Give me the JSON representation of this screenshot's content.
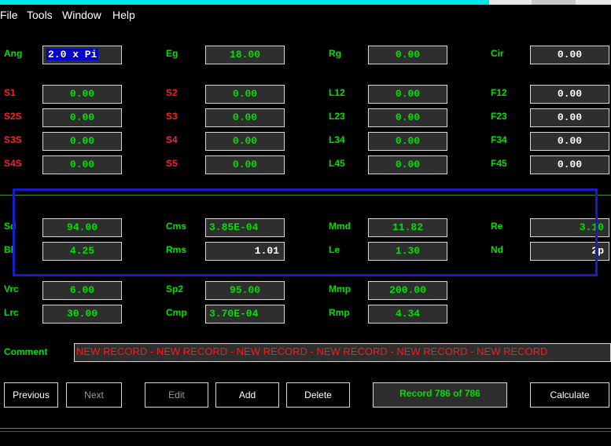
{
  "colors": {
    "accent_titlebar": "#00e5e5",
    "label_green": "#00e000",
    "label_red": "#ff2020",
    "value_green": "#00e000",
    "value_white": "#ffffff",
    "highlight_blue": "#1a1acc",
    "comment_red": "#ff1a1a"
  },
  "menu": [
    "File",
    "Tools",
    "Window",
    "Help"
  ],
  "fields": {
    "ang": {
      "label": "Ang",
      "value": "2.0 x Pi"
    },
    "eg": {
      "label": "Eg",
      "value": "18.00"
    },
    "rg": {
      "label": "Rg",
      "value": "0.00"
    },
    "cir": {
      "label": "Cir",
      "value": "0.00"
    },
    "s1": {
      "label": "S1",
      "value": "0.00"
    },
    "s2": {
      "label": "S2",
      "value": "0.00"
    },
    "l12": {
      "label": "L12",
      "value": "0.00"
    },
    "f12": {
      "label": "F12",
      "value": "0.00"
    },
    "s2s": {
      "label": "S2S",
      "value": "0.00"
    },
    "s3": {
      "label": "S3",
      "value": "0.00"
    },
    "l23": {
      "label": "L23",
      "value": "0.00"
    },
    "f23": {
      "label": "F23",
      "value": "0.00"
    },
    "s3s": {
      "label": "S3S",
      "value": "0.00"
    },
    "s4": {
      "label": "S4",
      "value": "0.00"
    },
    "l34": {
      "label": "L34",
      "value": "0.00"
    },
    "f34": {
      "label": "F34",
      "value": "0.00"
    },
    "s4s": {
      "label": "S4S",
      "value": "0.00"
    },
    "s5": {
      "label": "S5",
      "value": "0.00"
    },
    "l45": {
      "label": "L45",
      "value": "0.00"
    },
    "f45": {
      "label": "F45",
      "value": "0.00"
    },
    "sd": {
      "label": "Sd",
      "value": "94.00"
    },
    "cms": {
      "label": "Cms",
      "value": "3.85E-04"
    },
    "mmd": {
      "label": "Mmd",
      "value": "11.82"
    },
    "re": {
      "label": "Re",
      "value": "3.10"
    },
    "bl": {
      "label": "Bl",
      "value": "4.25"
    },
    "rms": {
      "label": "Rms",
      "value": "1.01"
    },
    "le": {
      "label": "Le",
      "value": "1.30"
    },
    "nd": {
      "label": "Nd",
      "value": "2p"
    },
    "vrc": {
      "label": "Vrc",
      "value": "6.00"
    },
    "sp2": {
      "label": "Sp2",
      "value": "95.00"
    },
    "mmp": {
      "label": "Mmp",
      "value": "200.00"
    },
    "lrc": {
      "label": "Lrc",
      "value": "30.00"
    },
    "cmp": {
      "label": "Cmp",
      "value": "3.70E-04"
    },
    "rmp": {
      "label": "Rmp",
      "value": "4.34"
    }
  },
  "comment": {
    "label": "Comment",
    "value": "NEW RECORD - NEW RECORD - NEW RECORD - NEW RECORD - NEW RECORD - NEW RECORD"
  },
  "buttons": {
    "previous": "Previous",
    "next": "Next",
    "edit": "Edit",
    "add": "Add",
    "delete": "Delete",
    "calculate": "Calculate"
  },
  "record_status": "Record 786 of 786"
}
